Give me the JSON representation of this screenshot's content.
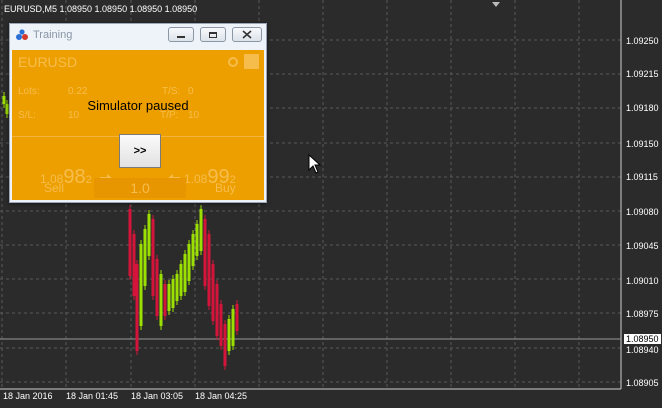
{
  "chart": {
    "header": "EURUSD,M5  1.08950 1.08950 1.08950 1.08950",
    "price_labels": [
      "1.09250",
      "1.09215",
      "1.09180",
      "1.09150",
      "1.09115",
      "1.09080",
      "1.09045",
      "1.09010",
      "1.08975",
      "1.08950",
      "1.08940",
      "1.08905"
    ],
    "time_labels": [
      "18 Jan 2016",
      "18 Jan 01:45",
      "18 Jan 03:05",
      "18 Jan 04:25"
    ],
    "colors": {
      "background": "#2b2b2b",
      "grid": "#5a5a5a",
      "bull": "#9be000",
      "bear": "#d4143b"
    }
  },
  "dialog": {
    "title": "Training",
    "symbol": "EURUSD",
    "lots_label": "Lots:",
    "lots_value": "0.22",
    "ts_label": "T/S:",
    "ts_value": "0",
    "sl_label": "S/L:",
    "sl_value": "10",
    "tp_label": "T/P:",
    "tp_value": "10",
    "sell_price_small": "1.08",
    "sell_price_big": "98",
    "sell_price_sup": "2",
    "buy_price_small": "1.08",
    "buy_price_big": "99",
    "buy_price_sup": "2",
    "sell_label": "Sell",
    "volume_value": "1.0",
    "buy_label": "Buy",
    "paused_text": "Simulator paused",
    "play_label": ">>",
    "panel_color": "#ed9f00"
  }
}
